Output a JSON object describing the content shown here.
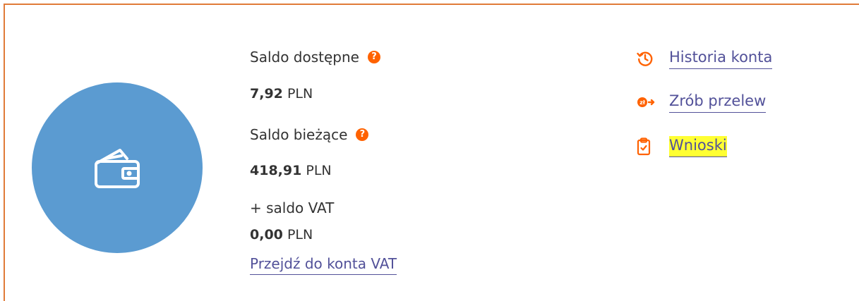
{
  "colors": {
    "accent_orange": "#ff6200",
    "border_orange": "#e07b39",
    "link_purple": "#525199",
    "wallet_blue": "#5b9bd1",
    "highlight_yellow": "#ffff33"
  },
  "balances": {
    "available": {
      "label": "Saldo dostępne",
      "amount": "7,92",
      "currency": "PLN"
    },
    "current": {
      "label": "Saldo bieżące",
      "amount": "418,91",
      "currency": "PLN"
    },
    "vat": {
      "label": "+ saldo VAT",
      "amount": "0,00",
      "currency": "PLN",
      "link_label": "Przejdź do konta VAT"
    }
  },
  "actions": [
    {
      "label": "Historia konta",
      "icon": "history-icon"
    },
    {
      "label": "Zrób przelew",
      "icon": "transfer-icon"
    },
    {
      "label": "Wnioski",
      "icon": "clipboard-icon"
    }
  ]
}
